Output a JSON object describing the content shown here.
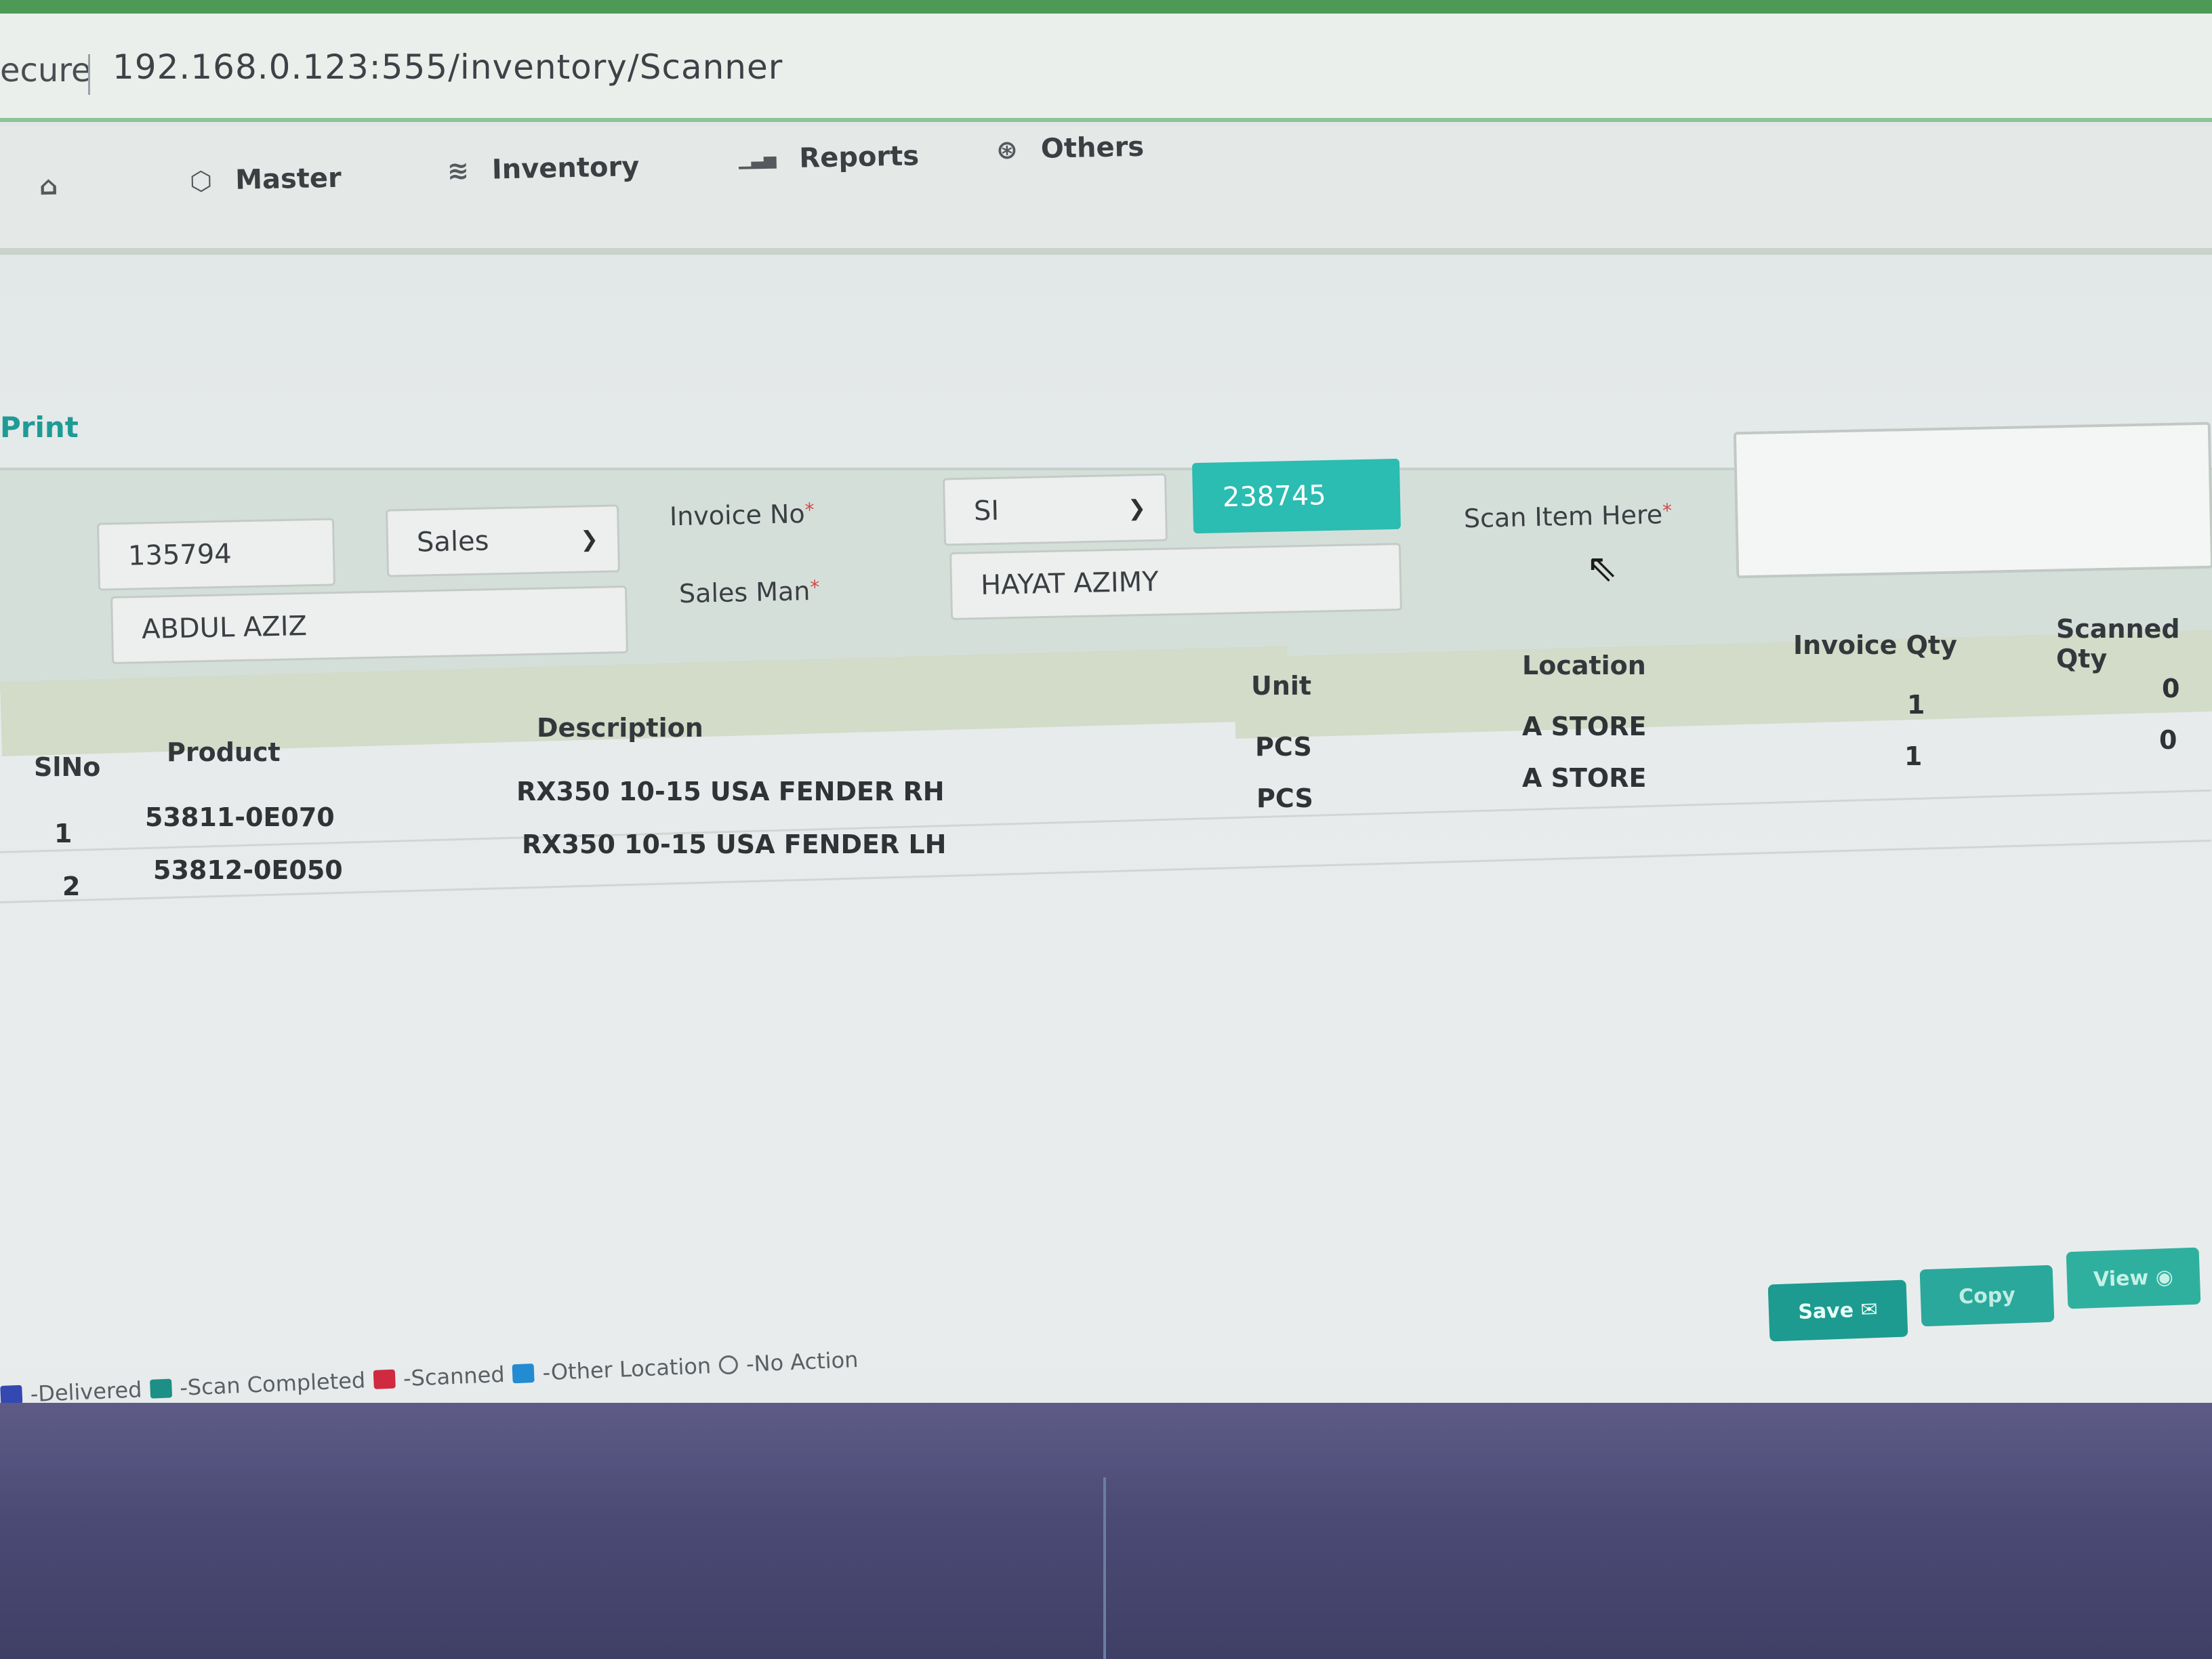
{
  "browser": {
    "secure_label": "ecure",
    "url": "192.168.0.123:555/inventory/Scanner"
  },
  "nav": {
    "home_icon": "⌂",
    "items": [
      {
        "label": "Master",
        "icon": "⬡"
      },
      {
        "label": "Inventory",
        "icon": "≋"
      },
      {
        "label": "Reports",
        "icon": "▁▃▅"
      },
      {
        "label": "Others",
        "icon": "⊛"
      }
    ]
  },
  "page": {
    "heading": "Print"
  },
  "form": {
    "doc_id": "135794",
    "type_select": "Sales",
    "customer": "ABDUL AZIZ",
    "invoice_no_label": "Invoice No",
    "invoice_prefix": "SI",
    "invoice_number": "238745",
    "sales_man_label": "Sales Man",
    "sales_man": "HAYAT AZIMY",
    "scan_label": "Scan Item Here",
    "required_mark": "*"
  },
  "table": {
    "columns": [
      "SlNo",
      "Product",
      "Description",
      "Unit",
      "Location",
      "Invoice Qty",
      "Scanned Qty"
    ],
    "rows": [
      {
        "slno": "1",
        "product": "53811-0E070",
        "description": "RX350 10-15 USA FENDER RH",
        "unit": "PCS",
        "location": "A STORE",
        "invoice_qty": "1",
        "scanned_qty": "0"
      },
      {
        "slno": "2",
        "product": "53812-0E050",
        "description": "RX350 10-15 USA FENDER LH",
        "unit": "PCS",
        "location": "A STORE",
        "invoice_qty": "1",
        "scanned_qty": "0"
      }
    ]
  },
  "buttons": {
    "save": "Save ✉",
    "copy": "Copy",
    "view": "View ◉"
  },
  "legend": {
    "delivered": "-Delivered",
    "scan_completed": "-Scan Completed",
    "scanned": "-Scanned",
    "other_location": "-Other Location",
    "no_action": "-No Action"
  },
  "colors": {
    "accent": "#2bbcb2",
    "header_text": "#1f9b95",
    "delivered": "#3448b2",
    "scan_completed": "#1c8f86",
    "scanned": "#cf2a40",
    "other_location": "#238bd1"
  }
}
